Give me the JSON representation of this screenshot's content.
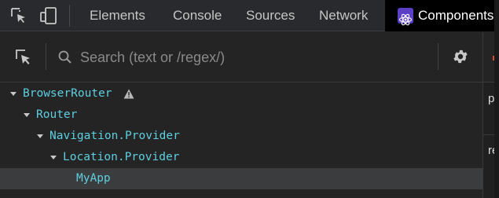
{
  "devtools": {
    "tabs": [
      {
        "label": "Elements"
      },
      {
        "label": "Console"
      },
      {
        "label": "Sources"
      },
      {
        "label": "Network"
      },
      {
        "label": "Components",
        "active": true
      }
    ]
  },
  "toolbar": {
    "search_placeholder": "Search (text or /regex/)"
  },
  "tree": {
    "nodes": [
      {
        "name": "BrowserRouter",
        "depth": 0,
        "expanded": true,
        "warning": true
      },
      {
        "name": "Router",
        "depth": 1,
        "expanded": true
      },
      {
        "name": "Navigation.Provider",
        "depth": 2,
        "expanded": true
      },
      {
        "name": "Location.Provider",
        "depth": 3,
        "expanded": true
      },
      {
        "name": "MyApp",
        "depth": 4,
        "selected": true
      }
    ]
  },
  "side_pane": {
    "row1": "pr",
    "row2": "re"
  },
  "colors": {
    "component_name": "#5ecfe0",
    "active_tab_bg": "#000000",
    "react_icon_bg": "#5b3fc4",
    "selected_row_bg": "#3b3c3e"
  }
}
